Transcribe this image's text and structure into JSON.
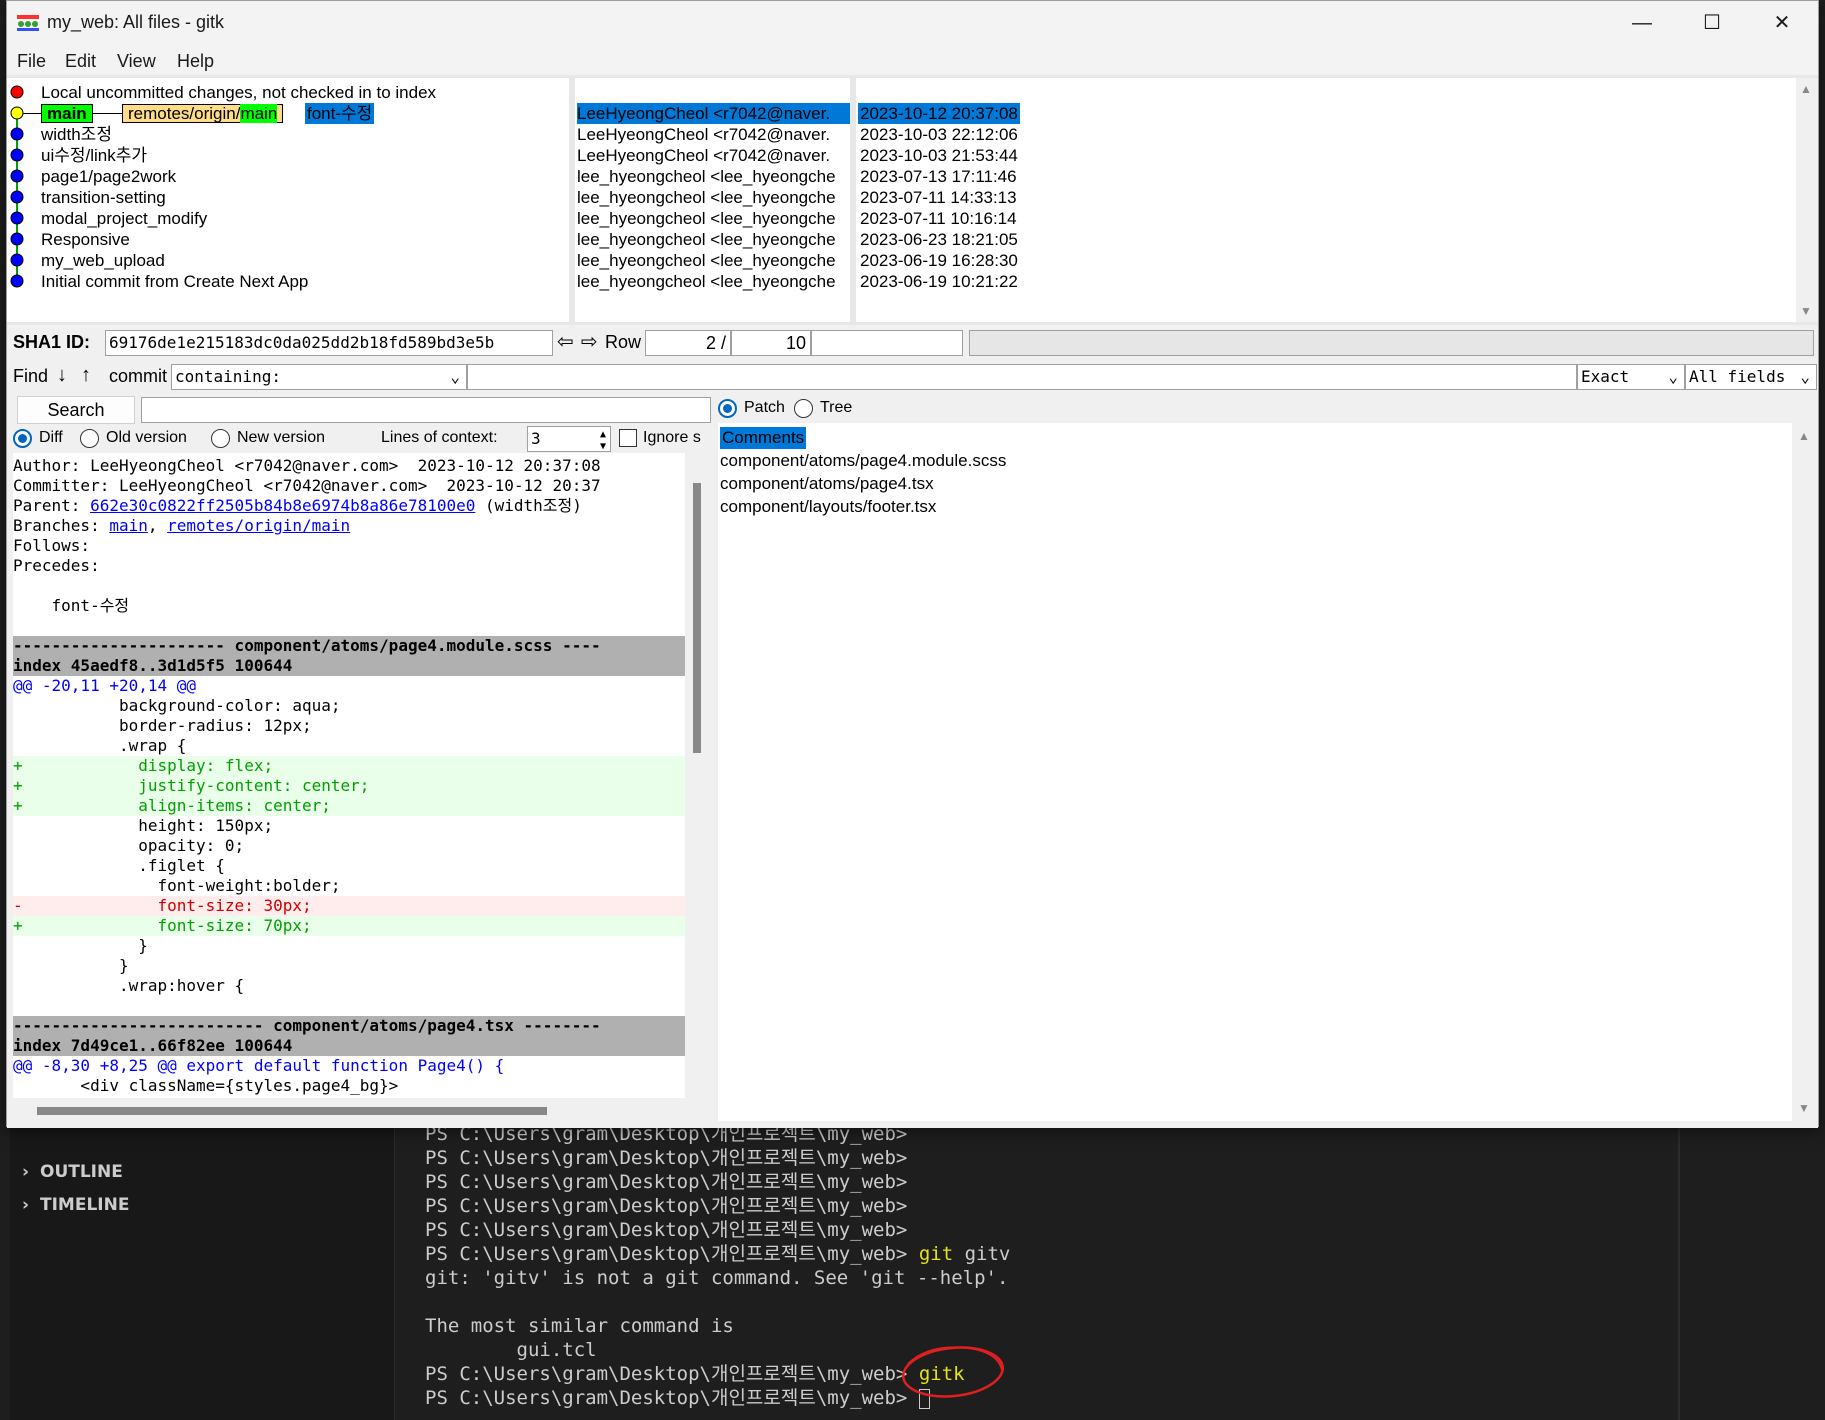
{
  "window": {
    "title": "my_web: All files - gitk",
    "minimize": "—",
    "maximize": "☐",
    "close": "✕"
  },
  "menu": [
    "File",
    "Edit",
    "View",
    "Help"
  ],
  "commits": [
    {
      "msg": "Local uncommitted changes, not checked in to index",
      "author": "",
      "date": "",
      "dot": "#ff0000"
    },
    {
      "msg": "",
      "author": "LeeHyeongCheol <r7042@naver.",
      "date": "2023-10-12 20:37:08",
      "dot": "#ffff00",
      "selected": true
    },
    {
      "msg": "width조정",
      "author": "LeeHyeongCheol <r7042@naver.",
      "date": "2023-10-03 22:12:06",
      "dot": "#0000ff"
    },
    {
      "msg": "ui수정/link추가",
      "author": "LeeHyeongCheol <r7042@naver.",
      "date": "2023-10-03 21:53:44",
      "dot": "#0000ff"
    },
    {
      "msg": "page1/page2work",
      "author": "lee_hyeongcheol <lee_hyeongche",
      "date": "2023-07-13 17:11:46",
      "dot": "#0000ff"
    },
    {
      "msg": "transition-setting",
      "author": "lee_hyeongcheol <lee_hyeongche",
      "date": "2023-07-11 14:33:13",
      "dot": "#0000ff"
    },
    {
      "msg": "modal_project_modify",
      "author": "lee_hyeongcheol <lee_hyeongche",
      "date": "2023-07-11 10:16:14",
      "dot": "#0000ff"
    },
    {
      "msg": "Responsive",
      "author": "lee_hyeongcheol <lee_hyeongche",
      "date": "2023-06-23 18:21:05",
      "dot": "#0000ff"
    },
    {
      "msg": "my_web_upload",
      "author": "lee_hyeongcheol <lee_hyeongche",
      "date": "2023-06-19 16:28:30",
      "dot": "#0000ff"
    },
    {
      "msg": "Initial commit from Create Next App",
      "author": "lee_hyeongcheol <lee_hyeongche",
      "date": "2023-06-19 10:21:22",
      "dot": "#0000ff"
    }
  ],
  "refs": {
    "main": "main",
    "remote_prefix": "remotes/origin/",
    "remote_main": "main",
    "head_msg": "font-수정"
  },
  "sha": {
    "label": "SHA1 ID:",
    "value": "69176de1e215183dc0da025dd2b18fd589bd3e5b",
    "row_label": "Row",
    "row_current": "2 /",
    "row_total": "10"
  },
  "find": {
    "label": "Find",
    "type": "commit",
    "mode": "containing:",
    "match": "Exact",
    "fields": "All fields"
  },
  "search": {
    "button": "Search",
    "diff": "Diff",
    "old_version": "Old version",
    "new_version": "New version",
    "context_label": "Lines of context:",
    "context_value": "3",
    "ignore": "Ignore s"
  },
  "right_options": {
    "patch": "Patch",
    "tree": "Tree"
  },
  "diff_lines": [
    {
      "t": "Author: LeeHyeongCheol <r7042@naver.com>  2023-10-12 20:37:08",
      "c": ""
    },
    {
      "t": "Committer: LeeHyeongCheol <r7042@naver.com>  2023-10-12 20:37",
      "c": ""
    },
    {
      "t": "Parent: ",
      "c": "",
      "link": "662e30c0822ff2505b84b8e6974b8a86e78100e0",
      "after": " (width조정)"
    },
    {
      "t": "Branches: ",
      "c": "",
      "link": "main",
      "after": ", ",
      "link2": "remotes/origin/main"
    },
    {
      "t": "Follows:",
      "c": ""
    },
    {
      "t": "Precedes:",
      "c": ""
    },
    {
      "t": "",
      "c": ""
    },
    {
      "t": "    font-수정",
      "c": ""
    },
    {
      "t": "",
      "c": ""
    },
    {
      "t": "---------------------- component/atoms/page4.module.scss ----",
      "c": "hdr"
    },
    {
      "t": "index 45aedf8..3d1d5f5 100644",
      "c": "hdr"
    },
    {
      "t": "@@ -20,11 +20,14 @@",
      "c": "hunk"
    },
    {
      "t": "           background-color: aqua;",
      "c": ""
    },
    {
      "t": "           border-radius: 12px;",
      "c": ""
    },
    {
      "t": "           .wrap {",
      "c": ""
    },
    {
      "t": "+            display: flex;",
      "c": "add"
    },
    {
      "t": "+            justify-content: center;",
      "c": "add"
    },
    {
      "t": "+            align-items: center;",
      "c": "add"
    },
    {
      "t": "             height: 150px;",
      "c": ""
    },
    {
      "t": "             opacity: 0;",
      "c": ""
    },
    {
      "t": "             .figlet {",
      "c": ""
    },
    {
      "t": "               font-weight:bolder;",
      "c": ""
    },
    {
      "t": "-              font-size: 30px;",
      "c": "del"
    },
    {
      "t": "+              font-size: 70px;",
      "c": "add"
    },
    {
      "t": "             }",
      "c": ""
    },
    {
      "t": "           }",
      "c": ""
    },
    {
      "t": "           .wrap:hover {",
      "c": ""
    },
    {
      "t": "",
      "c": ""
    },
    {
      "t": "-------------------------- component/atoms/page4.tsx --------",
      "c": "hdr"
    },
    {
      "t": "index 7d49ce1..66f82ee 100644",
      "c": "hdr"
    },
    {
      "t": "@@ -8,30 +8,25 @@ export default function Page4() {",
      "c": "hunk"
    },
    {
      "t": "       <div className={styles.page4_bg}>",
      "c": ""
    }
  ],
  "files": [
    "Comments",
    "component/atoms/page4.module.scss",
    "component/atoms/page4.tsx",
    "component/layouts/footer.tsx"
  ],
  "vscode": {
    "outline": "OUTLINE",
    "timeline": "TIMELINE"
  },
  "terminal": [
    {
      "p": "PS C:\\Users\\gram\\Desktop\\개인프로젝트\\my_web>",
      "cmd": "",
      "arg": ""
    },
    {
      "p": "PS C:\\Users\\gram\\Desktop\\개인프로젝트\\my_web>",
      "cmd": "",
      "arg": ""
    },
    {
      "p": "PS C:\\Users\\gram\\Desktop\\개인프로젝트\\my_web>",
      "cmd": "",
      "arg": ""
    },
    {
      "p": "PS C:\\Users\\gram\\Desktop\\개인프로젝트\\my_web>",
      "cmd": "",
      "arg": ""
    },
    {
      "p": "PS C:\\Users\\gram\\Desktop\\개인프로젝트\\my_web>",
      "cmd": "",
      "arg": ""
    },
    {
      "p": "PS C:\\Users\\gram\\Desktop\\개인프로젝트\\my_web>",
      "cmd": " git",
      "arg": " gitv"
    },
    {
      "p": "git: 'gitv' is not a git command. See 'git --help'.",
      "cmd": "",
      "arg": ""
    },
    {
      "p": "",
      "cmd": "",
      "arg": ""
    },
    {
      "p": "The most similar command is",
      "cmd": "",
      "arg": ""
    },
    {
      "p": "        gui.tcl",
      "cmd": "",
      "arg": ""
    },
    {
      "p": "PS C:\\Users\\gram\\Desktop\\개인프로젝트\\my_web>",
      "cmd": " gitk",
      "arg": ""
    },
    {
      "p": "PS C:\\Users\\gram\\Desktop\\개인프로젝트\\my_web>",
      "cmd": "",
      "arg": "",
      "cursor": true
    }
  ],
  "colors": {
    "selection": "#0078d7",
    "main_tag": "#00ff00",
    "remote_tag": "#ffdd88",
    "add": "#00a000",
    "del": "#d00000",
    "hunk": "#0000ff"
  }
}
